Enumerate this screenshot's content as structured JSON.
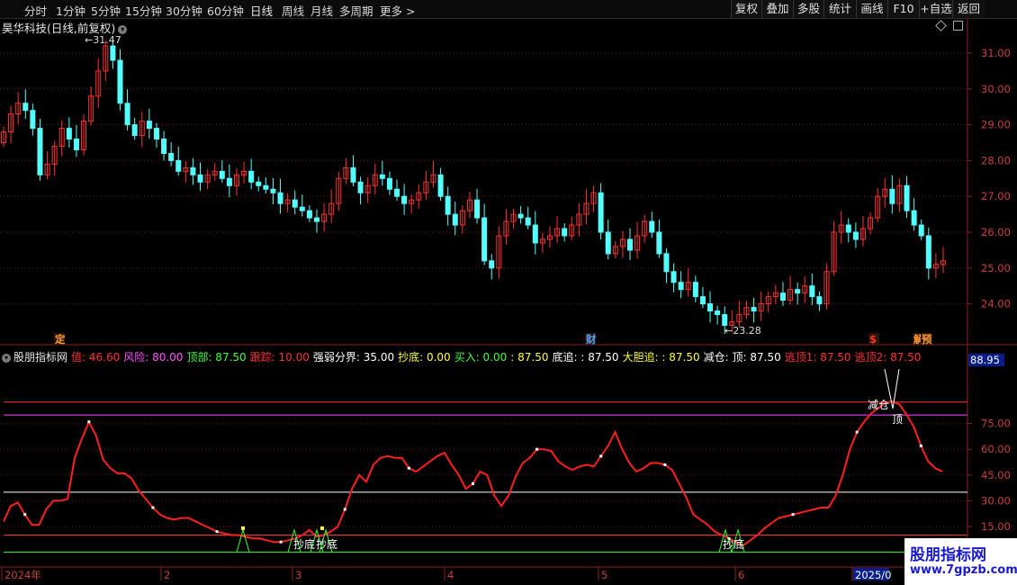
{
  "toolbar": {
    "periods": [
      "分时",
      "1分钟",
      "5分钟",
      "15分钟",
      "30分钟",
      "60分钟",
      "日线",
      "周线",
      "月线",
      "多周期",
      "更多 >"
    ],
    "active_period": "日线",
    "buttons": [
      "复权",
      "叠加",
      "多股",
      "统计",
      "画线",
      "F10",
      "+自选",
      "返回"
    ]
  },
  "main_chart": {
    "title": "昊华科技(日线,前复权)",
    "high_label": "31.47",
    "low_label": "23.28",
    "y_ticks": [
      "31.00",
      "30.00",
      "29.00",
      "28.00",
      "27.00",
      "26.00",
      "25.00",
      "24.00"
    ],
    "markers": [
      {
        "text": "定",
        "color": "#ff9a3c"
      },
      {
        "text": "财",
        "color": "#5aa0ff"
      },
      {
        "text": "$",
        "color": "#ff3333"
      },
      {
        "text": "解",
        "color": "#ff9a3c"
      },
      {
        "text": "预",
        "color": "#ff9a3c"
      }
    ],
    "up_color": "#ff3232",
    "down_color": "#54ffff"
  },
  "indicator": {
    "name": "股朋指标网",
    "params": [
      {
        "label": "值: 46.60",
        "color": "#ff3232"
      },
      {
        "label": "风险: 80.00",
        "color": "#ff55ff"
      },
      {
        "label": "顶部: 87.50",
        "color": "#3cff3c"
      },
      {
        "label": "跟踪: 10.00",
        "color": "#ff3232"
      },
      {
        "label": "强弱分界: 35.00",
        "color": "#ffffff"
      },
      {
        "label": "抄底: 0.00",
        "color": "#ffff3c"
      },
      {
        "label": "买入: 0.00",
        "color": "#3cff3c"
      },
      {
        "label": ": 87.50",
        "color": "#ffff3c"
      },
      {
        "label": "底追: : 87.50",
        "color": "#ffffff"
      },
      {
        "label": "大胆追: : 87.50",
        "color": "#ffff3c"
      },
      {
        "label": "减仓: 顶: 87.50",
        "color": "#ffffff"
      },
      {
        "label": "逃顶1: 87.50",
        "color": "#ff3232"
      },
      {
        "label": "逃顶2: 87.50",
        "color": "#ff3232"
      }
    ],
    "y_ticks": [
      "75.00",
      "60.00",
      "45.00",
      "30.00",
      "15.00"
    ],
    "current_value": "88.95",
    "signal_labels": [
      "抄底",
      "抄底",
      "抄底",
      "减仓",
      "顶"
    ],
    "levels": {
      "risk": 80,
      "top": 87.5,
      "divide": 35,
      "track": 10,
      "zero": 0
    },
    "series": [
      18,
      27,
      29,
      22,
      16,
      16,
      25,
      30,
      30,
      31,
      55,
      66,
      76,
      68,
      54,
      49,
      46,
      46,
      43,
      36,
      31,
      26,
      22,
      20,
      19,
      20,
      20,
      18,
      16,
      14,
      12,
      11,
      10,
      10,
      9,
      8,
      8,
      7,
      6,
      6,
      7,
      8,
      10,
      13,
      9,
      10,
      12,
      15,
      25,
      37,
      45,
      41,
      51,
      55,
      56,
      55,
      55,
      49,
      47,
      50,
      53,
      56,
      58,
      51,
      45,
      37,
      40,
      47,
      45,
      33,
      27,
      33,
      44,
      52,
      55,
      60,
      60,
      59,
      53,
      50,
      48,
      50,
      51,
      50,
      56,
      62,
      70,
      60,
      52,
      47,
      49,
      52,
      52,
      51,
      48,
      40,
      32,
      22,
      19,
      16,
      12,
      10,
      8,
      6,
      4,
      7,
      10,
      14,
      17,
      20,
      21,
      22,
      23,
      24,
      25,
      26,
      26,
      33,
      45,
      60,
      70,
      76,
      81,
      84,
      87,
      88,
      86,
      80,
      73,
      62,
      53,
      49,
      47
    ]
  },
  "x_axis": {
    "labels": [
      "2024年",
      "2",
      "3",
      "4",
      "5",
      "6",
      "2025/0"
    ]
  },
  "brand": {
    "title": "股朋指标网",
    "url": "www.7gpzb.com"
  }
}
